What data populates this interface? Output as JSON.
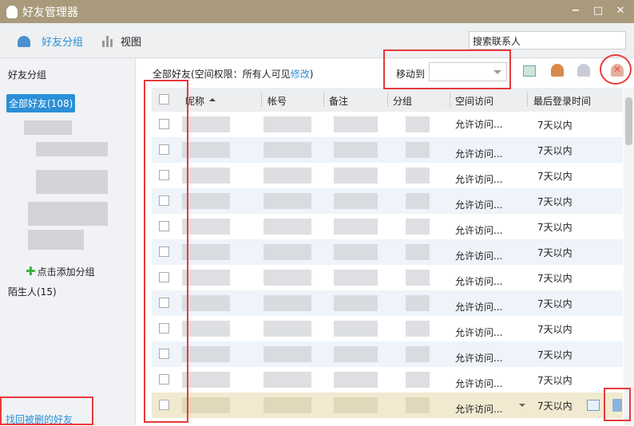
{
  "window": {
    "title": "好友管理器",
    "minimize": "−",
    "maximize": "□",
    "close": "✕"
  },
  "toolbar": {
    "tab_groups": "好友分组",
    "tab_view": "视图",
    "search_placeholder": "搜索联系人"
  },
  "sidebar": {
    "heading": "好友分组",
    "all_friends": "全部好友(108)",
    "add_group": "点击添加分组",
    "strangers": "陌生人(15)",
    "recover": "找回被删的好友"
  },
  "main": {
    "title_prefix": "全部好友(空间权限：所有人可见",
    "modify": "修改",
    "title_suffix": ")",
    "move_to": "移动到"
  },
  "table": {
    "headers": [
      "昵称",
      "帐号",
      "备注",
      "分组",
      "空间访问",
      "最后登录时间"
    ],
    "rows": [
      {
        "space": "允许访问...",
        "last": "7天以内"
      },
      {
        "space": "允许访问...",
        "last": "7天以内"
      },
      {
        "space": "允许访问...",
        "last": "7天以内"
      },
      {
        "space": "允许访问...",
        "last": "7天以内"
      },
      {
        "space": "允许访问...",
        "last": "7天以内"
      },
      {
        "space": "允许访问...",
        "last": "7天以内"
      },
      {
        "space": "允许访问...",
        "last": "7天以内"
      },
      {
        "space": "允许访问...",
        "last": "7天以内"
      },
      {
        "space": "允许访问...",
        "last": "7天以内"
      },
      {
        "space": "允许访问...",
        "last": "7天以内"
      },
      {
        "space": "允许访问...",
        "last": "7天以内"
      },
      {
        "space": "允许访问...",
        "last": "7天以内"
      }
    ]
  },
  "colors": {
    "titlebar": "#a99a7c",
    "accent": "#2a8fd8",
    "annotation": "#e83a3a"
  }
}
